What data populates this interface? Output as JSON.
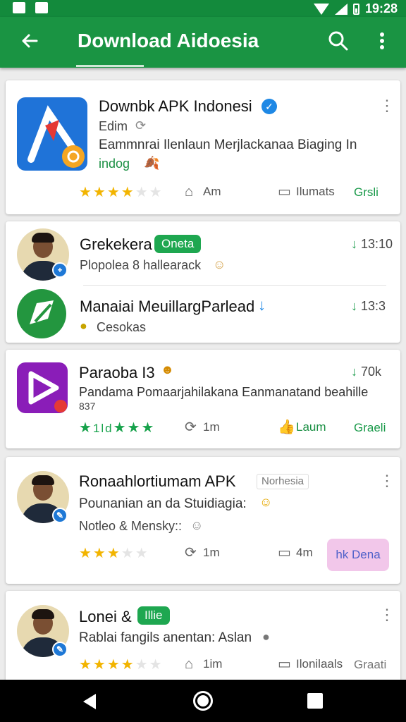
{
  "status_bar": {
    "time": "19:28"
  },
  "app_bar": {
    "title": "Download Aidoesia"
  },
  "cards": [
    {
      "title": "Downbk APK Indonesi",
      "author": "Edim",
      "description": "Eammnrai Ilenlaun Merjlackanaa Biaging In",
      "tag": "indog",
      "rating": 3.5,
      "meta1": "Am",
      "meta2": "Ilumats",
      "price": "Grsli"
    },
    {
      "items": [
        {
          "title": "Grekekera",
          "badge": "Oneta",
          "sub": "Plopolea 8 hallearack",
          "time": "13:10"
        },
        {
          "title": "Manaiai MeuillargParlead",
          "sub": "Cesokas",
          "time": "13:3"
        }
      ]
    },
    {
      "title": "Paraoba I3",
      "size": "70k",
      "desc_line1": "Pandama Pomaarjahilakana Eanmanatand beahille",
      "desc_line2": "837",
      "rating_text": "1ld",
      "meta1": "1m",
      "meta2": "Laum",
      "price": "Graeli"
    },
    {
      "title": "Ronaahlortiumam APK",
      "tag": "Norhesia",
      "desc": "Pounanian an da Stuidiagia:",
      "sub": "Notleo & Mensky::",
      "rating": 3.5,
      "meta1": "1m",
      "meta2": "4m",
      "action": "hk Dena"
    },
    {
      "title": "Lonei &",
      "badge": "Illie",
      "desc": "Rablai fangils anentan: Aslan",
      "rating": 3.5,
      "meta1": "1im",
      "meta2": "Ilonilaals",
      "price": "Graati"
    }
  ],
  "colors": {
    "primary": "#1a9443",
    "status": "#138a3c",
    "accent_green": "#1a9a4a",
    "star": "#f2b400"
  }
}
